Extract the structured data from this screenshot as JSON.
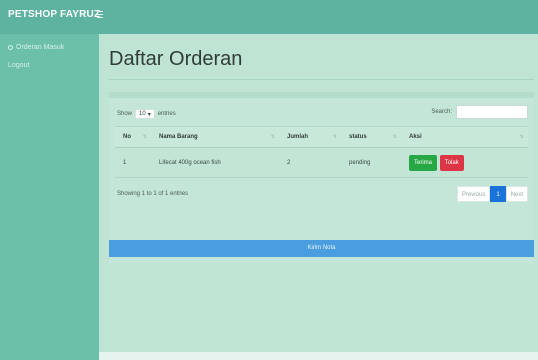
{
  "app": {
    "brand": "PETSHOP FAYRUZ"
  },
  "sidebar": {
    "items": [
      {
        "label": "Orderan Masuk"
      },
      {
        "label": "Logout"
      }
    ]
  },
  "page": {
    "title": "Daftar Orderan"
  },
  "table_controls": {
    "show_label": "Show",
    "length_value": "10",
    "entries_label": "entries",
    "search_label": "Search:",
    "search_value": ""
  },
  "table": {
    "columns": [
      "No",
      "Nama Barang",
      "Jumlah",
      "status",
      "Aksi"
    ],
    "rows": [
      {
        "no": "1",
        "nama_barang": "Lifecat 400g ocean fish",
        "jumlah": "2",
        "status": "pending",
        "actions": {
          "accept": "Terima",
          "reject": "Tolak"
        }
      }
    ]
  },
  "table_footer": {
    "info": "Showing 1 to 1 of 1 entries",
    "pagination": {
      "previous": "Previous",
      "current": "1",
      "next": "Next"
    }
  },
  "submit_button": {
    "label": "Kirim Nota"
  },
  "colors": {
    "topbar": "#5eb3a0",
    "sidebar": "#6cc0aa",
    "accept": "#28a745",
    "reject": "#dc3545",
    "primary": "#4a9ee0",
    "pager_active": "#1a73d9"
  }
}
